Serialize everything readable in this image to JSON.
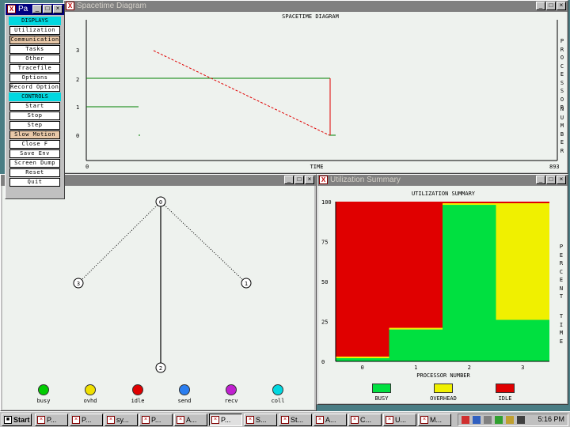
{
  "spacetime": {
    "title": "Spacetime Diagram",
    "heading": "SPACETIME DIAGRAM",
    "y_ticks": [
      "3",
      "2",
      "1",
      "0"
    ],
    "x_start": "0",
    "x_end": "893",
    "x_label": "TIME",
    "side_label_top": "PROCESSOR",
    "side_label_bottom": "NUMBER"
  },
  "control_panel": {
    "title": "Pa",
    "section_displays": "DISPLAYS",
    "section_controls": "CONTROLS",
    "displays": [
      "Utilization",
      "Communication",
      "Tasks",
      "Other",
      "Tracefile",
      "Options",
      "Record Options"
    ],
    "controls": [
      "Start",
      "Step",
      "Slow Motion",
      "Close F",
      "Save Env",
      "Screen Dump",
      "Reset",
      "Quit"
    ],
    "step_under": "Stop"
  },
  "kiviat": {
    "nodes": [
      "0",
      "1",
      "2",
      "3"
    ],
    "legend": [
      {
        "label": "busy",
        "color": "#00cc00"
      },
      {
        "label": "ovhd",
        "color": "#f0e000"
      },
      {
        "label": "idle",
        "color": "#e00000"
      },
      {
        "label": "send",
        "color": "#2a7ef0"
      },
      {
        "label": "recv",
        "color": "#c020d0"
      },
      {
        "label": "coll",
        "color": "#00d8e0"
      }
    ]
  },
  "utilization": {
    "title": "Utilization Summary",
    "heading": "UTILIZATION SUMMARY",
    "y_ticks": [
      "100",
      "75",
      "50",
      "25",
      "0"
    ],
    "x_label": "PROCESSOR NUMBER",
    "side_label_top": "PERCENT",
    "side_label_bottom": "TIME",
    "legend": [
      {
        "label": "BUSY",
        "color": "#00e040"
      },
      {
        "label": "OVERHEAD",
        "color": "#f0f000"
      },
      {
        "label": "IDLE",
        "color": "#e00000"
      }
    ]
  },
  "chart_data": {
    "type": "bar",
    "title": "UTILIZATION SUMMARY",
    "xlabel": "PROCESSOR NUMBER",
    "ylabel": "PERCENT TIME",
    "categories": [
      "0",
      "1",
      "2",
      "3"
    ],
    "ylim": [
      0,
      100
    ],
    "stacked": true,
    "series": [
      {
        "name": "BUSY",
        "color": "#00e040",
        "values": [
          2,
          20,
          98,
          26
        ]
      },
      {
        "name": "OVERHEAD",
        "color": "#f0f000",
        "values": [
          1,
          1,
          1,
          73
        ]
      },
      {
        "name": "IDLE",
        "color": "#e00000",
        "values": [
          97,
          79,
          1,
          1
        ]
      }
    ]
  },
  "taskbar": {
    "start": "Start",
    "tasks": [
      "P...",
      "P...",
      "sy...",
      "P...",
      "A...",
      "P...",
      "S...",
      "St...",
      "A...",
      "C...",
      "U...",
      "M..."
    ],
    "clock": "5:16 PM"
  }
}
